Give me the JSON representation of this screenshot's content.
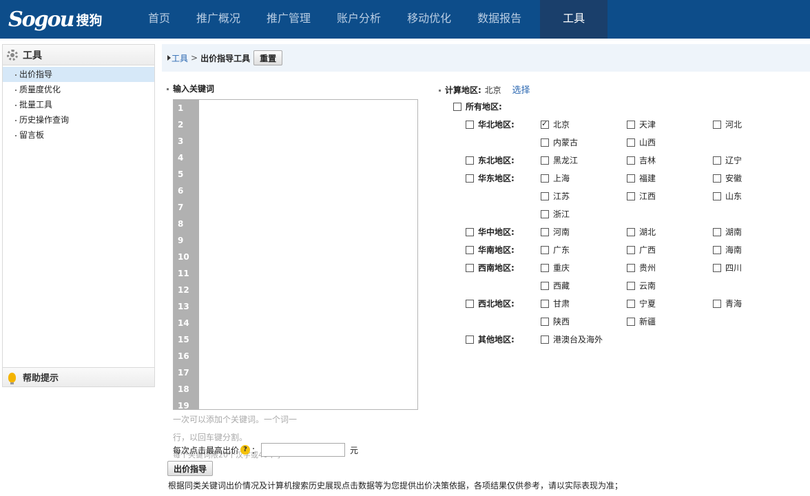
{
  "brand": {
    "logo": "Sogou",
    "logo_cn": "搜狗"
  },
  "nav": [
    "首页",
    "推广概况",
    "推广管理",
    "账户分析",
    "移动优化",
    "数据报告",
    "工具"
  ],
  "nav_active": "工具",
  "sidebar": {
    "title": "工具",
    "items": [
      "出价指导",
      "质量度优化",
      "批量工具",
      "历史操作查询",
      "留言板"
    ],
    "active": "出价指导",
    "help": "帮助提示"
  },
  "breadcrumb": {
    "root": "工具",
    "sep": ">",
    "current": "出价指导工具",
    "reset": "重置"
  },
  "keywords": {
    "title": "输入关键词",
    "line_numbers": [
      "1",
      "2",
      "3",
      "4",
      "5",
      "6",
      "7",
      "8",
      "9",
      "10",
      "11",
      "12",
      "13",
      "14",
      "15",
      "16",
      "17",
      "18",
      "19"
    ],
    "hint1": "一次可以添加个关键词。一个词一",
    "hint2": "行，以回车键分割。",
    "hint3": "每个关键词限20个汉字或40个字",
    "max_bid_label": "每次点击最高出价",
    "qmark": "?",
    "colon": "：",
    "unit": "元",
    "submit": "出价指导",
    "footnote": "根据同类关键词出价情况及计算机搜索历史展现点击数据等为您提供出价决策依据，各项结果仅供参考，请以实际表现为准；"
  },
  "regions": {
    "label": "计算地区:",
    "value": "北京",
    "select": "选择",
    "all": "所有地区:",
    "rows": [
      {
        "group": "华北地区:",
        "provinces": [
          {
            "name": "北京",
            "checked": true
          },
          {
            "name": "天津"
          },
          {
            "name": "河北"
          }
        ]
      },
      {
        "group": "",
        "provinces": [
          {
            "name": "内蒙古"
          },
          {
            "name": "山西"
          }
        ]
      },
      {
        "group": "东北地区:",
        "provinces": [
          {
            "name": "黑龙江"
          },
          {
            "name": "吉林"
          },
          {
            "name": "辽宁"
          }
        ]
      },
      {
        "group": "华东地区:",
        "provinces": [
          {
            "name": "上海"
          },
          {
            "name": "福建"
          },
          {
            "name": "安徽"
          }
        ]
      },
      {
        "group": "",
        "provinces": [
          {
            "name": "江苏"
          },
          {
            "name": "江西"
          },
          {
            "name": "山东"
          }
        ]
      },
      {
        "group": "",
        "provinces": [
          {
            "name": "浙江"
          }
        ]
      },
      {
        "group": "华中地区:",
        "provinces": [
          {
            "name": "河南"
          },
          {
            "name": "湖北"
          },
          {
            "name": "湖南"
          }
        ]
      },
      {
        "group": "华南地区:",
        "provinces": [
          {
            "name": "广东"
          },
          {
            "name": "广西"
          },
          {
            "name": "海南"
          }
        ]
      },
      {
        "group": "西南地区:",
        "provinces": [
          {
            "name": "重庆"
          },
          {
            "name": "贵州"
          },
          {
            "name": "四川"
          }
        ]
      },
      {
        "group": "",
        "provinces": [
          {
            "name": "西藏"
          },
          {
            "name": "云南"
          }
        ]
      },
      {
        "group": "西北地区:",
        "provinces": [
          {
            "name": "甘肃"
          },
          {
            "name": "宁夏"
          },
          {
            "name": "青海"
          }
        ]
      },
      {
        "group": "",
        "provinces": [
          {
            "name": "陕西"
          },
          {
            "name": "新疆"
          }
        ]
      },
      {
        "group": "其他地区:",
        "provinces": [
          {
            "name": "港澳台及海外"
          }
        ]
      }
    ]
  }
}
